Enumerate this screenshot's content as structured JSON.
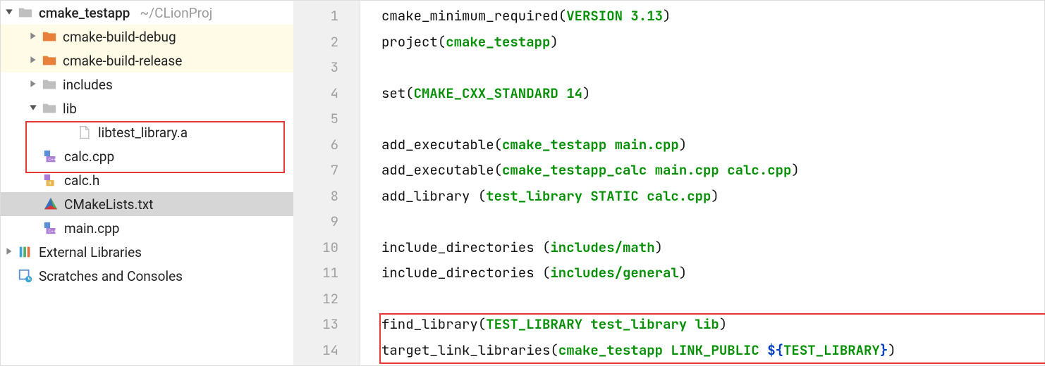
{
  "project": {
    "root_name": "cmake_testapp",
    "root_path": "~/CLionProj",
    "items": {
      "build_debug": "cmake-build-debug",
      "build_release": "cmake-build-release",
      "includes": "includes",
      "lib": "lib",
      "lib_file": "libtest_library.a",
      "calc_cpp": "calc.cpp",
      "calc_h": "calc.h",
      "cmakelists": "CMakeLists.txt",
      "main_cpp": "main.cpp"
    },
    "external_libs": "External Libraries",
    "scratches": "Scratches and Consoles"
  },
  "editor": {
    "lines": [
      {
        "frags": [
          {
            "t": "cmake_minimum_required("
          },
          {
            "t": "VERSION 3.13",
            "c": "g"
          },
          {
            "t": ")"
          }
        ]
      },
      {
        "frags": [
          {
            "t": "project("
          },
          {
            "t": "cmake_testapp",
            "c": "g"
          },
          {
            "t": ")"
          }
        ]
      },
      {
        "frags": []
      },
      {
        "frags": [
          {
            "t": "set("
          },
          {
            "t": "CMAKE_CXX_STANDARD 14",
            "c": "g"
          },
          {
            "t": ")"
          }
        ]
      },
      {
        "frags": []
      },
      {
        "frags": [
          {
            "t": "add_executable("
          },
          {
            "t": "cmake_testapp main.cpp",
            "c": "g"
          },
          {
            "t": ")"
          }
        ]
      },
      {
        "frags": [
          {
            "t": "add_executable("
          },
          {
            "t": "cmake_testapp_calc main.cpp calc.cpp",
            "c": "g"
          },
          {
            "t": ")"
          }
        ]
      },
      {
        "frags": [
          {
            "t": "add_library ("
          },
          {
            "t": "test_library STATIC calc.cpp",
            "c": "g"
          },
          {
            "t": ")"
          }
        ]
      },
      {
        "frags": []
      },
      {
        "frags": [
          {
            "t": "include_directories ("
          },
          {
            "t": "includes/math",
            "c": "g"
          },
          {
            "t": ")"
          }
        ]
      },
      {
        "frags": [
          {
            "t": "include_directories ("
          },
          {
            "t": "includes/general",
            "c": "g"
          },
          {
            "t": ")"
          }
        ]
      },
      {
        "frags": []
      },
      {
        "frags": [
          {
            "t": "find_library("
          },
          {
            "t": "TEST_LIBRARY test_library lib",
            "c": "g"
          },
          {
            "t": ")"
          }
        ]
      },
      {
        "frags": [
          {
            "t": "target_link_libraries("
          },
          {
            "t": "cmake_testapp LINK_PUBLIC ",
            "c": "g"
          },
          {
            "t": "${",
            "c": "d"
          },
          {
            "t": "TEST_LIBRARY",
            "c": "g"
          },
          {
            "t": "}",
            "c": "d"
          },
          {
            "t": ")"
          }
        ]
      }
    ]
  }
}
